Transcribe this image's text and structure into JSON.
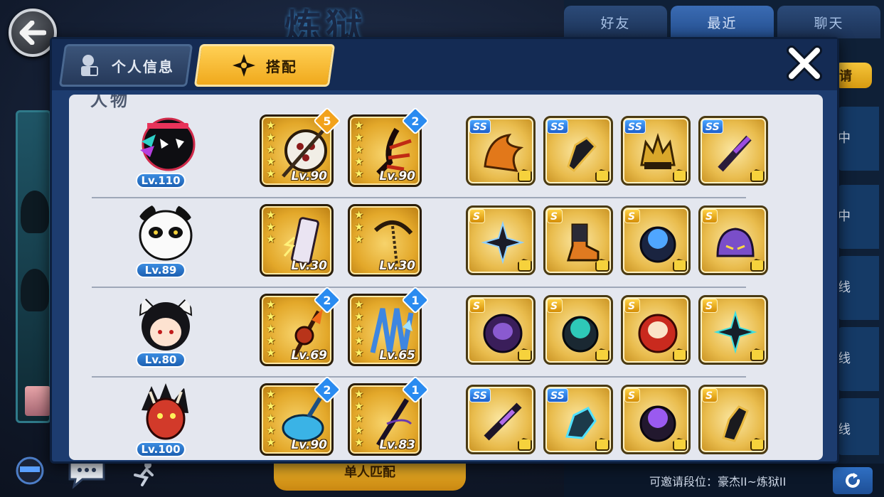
{
  "background": {
    "friends_tabs": [
      "好友",
      "最近",
      "聊天"
    ],
    "invite_label": "请",
    "list_status": [
      "中",
      "中",
      "线",
      "线",
      "线"
    ],
    "invite_rank_text": "可邀请段位：豪杰II~炼狱II",
    "bottom_button": "单人匹配"
  },
  "modal": {
    "tabs": [
      {
        "label": "个人信息",
        "icon": "person-icon",
        "active": false
      },
      {
        "label": "搭配",
        "icon": "shuriken-icon",
        "active": true
      }
    ],
    "section_label": "人物",
    "rows": [
      {
        "character": "black-stickman-ninja",
        "level": "Lv.110",
        "weapons": [
          {
            "name": "round-blade-weapon",
            "stars": 5,
            "level": "Lv.90",
            "badge": "5",
            "badge_color": "#f2a21b"
          },
          {
            "name": "red-claw-weapon",
            "stars": 5,
            "level": "Lv.90",
            "badge": "2",
            "badge_color": "#2a8bf0"
          }
        ],
        "items": [
          {
            "name": "flame-scroll-item",
            "grade": "SS"
          },
          {
            "name": "dark-gauntlet-item",
            "grade": "SS"
          },
          {
            "name": "spiked-helm-item",
            "grade": "SS"
          },
          {
            "name": "purple-blade-item",
            "grade": "SS"
          }
        ]
      },
      {
        "character": "panda-ninja",
        "level": "Lv.89",
        "weapons": [
          {
            "name": "lightning-phone-weapon",
            "stars": 3,
            "level": "Lv.30",
            "badge": "",
            "badge_color": ""
          },
          {
            "name": "sickle-chain-weapon",
            "stars": 3,
            "level": "Lv.30",
            "badge": "",
            "badge_color": ""
          }
        ],
        "items": [
          {
            "name": "shuriken-item",
            "grade": "S"
          },
          {
            "name": "ninja-boot-item",
            "grade": "S"
          },
          {
            "name": "blue-orb-ring-item",
            "grade": "S"
          },
          {
            "name": "purple-helmet-item",
            "grade": "S"
          }
        ]
      },
      {
        "character": "cat-ear-girl",
        "level": "Lv.80",
        "weapons": [
          {
            "name": "fire-staff-weapon",
            "stars": 5,
            "level": "Lv.69",
            "badge": "2",
            "badge_color": "#2a8bf0"
          },
          {
            "name": "ice-fan-weapon",
            "stars": 5,
            "level": "Lv.65",
            "badge": "1",
            "badge_color": "#2a8bf0"
          }
        ],
        "items": [
          {
            "name": "purple-daruma-item",
            "grade": "S"
          },
          {
            "name": "teal-orb-ring-item",
            "grade": "S"
          },
          {
            "name": "red-daruma-item",
            "grade": "S"
          },
          {
            "name": "dark-shuriken-item",
            "grade": "S"
          }
        ]
      },
      {
        "character": "oni-mask-ninja",
        "level": "Lv.100",
        "weapons": [
          {
            "name": "water-hammer-weapon",
            "stars": 5,
            "level": "Lv.90",
            "badge": "2",
            "badge_color": "#2a8bf0"
          },
          {
            "name": "dark-katana-weapon",
            "stars": 5,
            "level": "Lv.83",
            "badge": "1",
            "badge_color": "#2a8bf0"
          }
        ],
        "items": [
          {
            "name": "violet-blade-item",
            "grade": "SS"
          },
          {
            "name": "crystal-gauntlet-item",
            "grade": "SS"
          },
          {
            "name": "violet-orb-ring-item",
            "grade": "S"
          },
          {
            "name": "black-glove-item",
            "grade": "S"
          }
        ]
      }
    ]
  }
}
